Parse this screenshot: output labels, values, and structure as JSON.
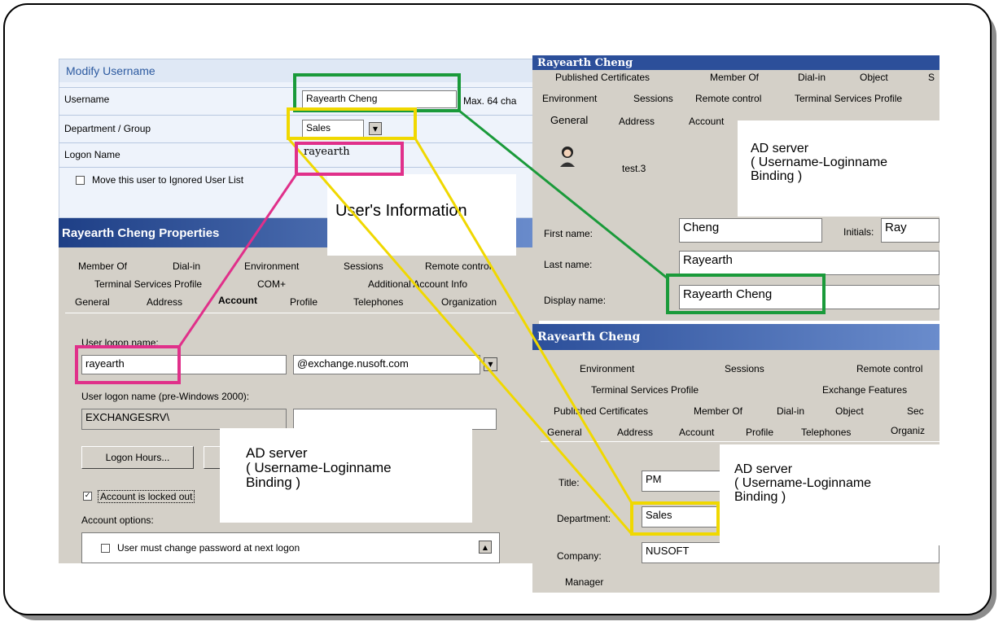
{
  "modify_panel": {
    "title": "Modify Username",
    "username_label": "Username",
    "username_value": "Rayearth Cheng",
    "max_hint": "Max. 64 cha",
    "department_label": "Department / Group",
    "department_value": "Sales",
    "logon_label": "Logon Name",
    "logon_value": "rayearth",
    "move_checkbox_label": "Move this user to Ignored User List"
  },
  "left_props": {
    "title": "Rayearth Cheng Properties",
    "tabs_row1": [
      "Member Of",
      "Dial-in",
      "Environment",
      "Sessions",
      "Remote control"
    ],
    "tabs_row2": [
      "Terminal Services Profile",
      "COM+",
      "Additional Account Info"
    ],
    "tabs_row3": [
      "General",
      "Address",
      "Account",
      "Profile",
      "Telephones",
      "Organization"
    ],
    "logon_name_label": "User logon name:",
    "logon_name_value": "rayearth",
    "domain_value": "@exchange.nusoft.com",
    "pre2000_label": "User logon name (pre-Windows 2000):",
    "pre2000_value": "EXCHANGESRV\\",
    "logon_hours_button": "Logon Hours...",
    "locked_label": "Account is locked out",
    "options_label": "Account options:",
    "option1": "User must change password at next logon"
  },
  "right_top": {
    "title": "Rayearth Cheng",
    "tabs_row1": [
      "Published Certificates",
      "Member Of",
      "Dial-in",
      "Object",
      "S"
    ],
    "tabs_row2": [
      "Environment",
      "Sessions",
      "Remote control",
      "Terminal Services Profile"
    ],
    "tabs_row3": [
      "General",
      "Address",
      "Account"
    ],
    "user_label": "test.3",
    "first_name_label": "First name:",
    "first_name_value": "Cheng",
    "initials_label": "Initials:",
    "initials_value": "Ray",
    "last_name_label": "Last name:",
    "last_name_value": "Rayearth",
    "display_name_label": "Display name:",
    "display_name_value": "Rayearth Cheng"
  },
  "right_bottom": {
    "title": "Rayearth Cheng",
    "tabs_row1": [
      "Environment",
      "Sessions",
      "Remote control"
    ],
    "tabs_row2": [
      "Terminal Services Profile",
      "Exchange Features"
    ],
    "tabs_row3": [
      "Published Certificates",
      "Member Of",
      "Dial-in",
      "Object",
      "Sec"
    ],
    "tabs_row4": [
      "General",
      "Address",
      "Account",
      "Profile",
      "Telephones",
      "Organiz"
    ],
    "title_label": "Title:",
    "title_value": "PM",
    "department_label": "Department:",
    "department_value": "Sales",
    "company_label": "Company:",
    "company_value": "NUSOFT",
    "manager_label": "Manager"
  },
  "annotations": {
    "users_info": "User's Information",
    "ad_top_line1": "AD server",
    "ad_top_line2": "( Username-Loginname",
    "ad_top_line3": "Binding )",
    "ad_left_line1": "AD server",
    "ad_left_line2": "( Username-Loginname",
    "ad_left_line3": "Binding )",
    "ad_right_line1": "AD server",
    "ad_right_line2": "( Username-Loginname",
    "ad_right_line3": "Binding )"
  },
  "colors": {
    "green": "#1a9a3a",
    "yellow": "#f0d800",
    "magenta": "#e0308a",
    "panel_blue": "#e8f0fa",
    "title_blue": "#2c4f9a"
  }
}
